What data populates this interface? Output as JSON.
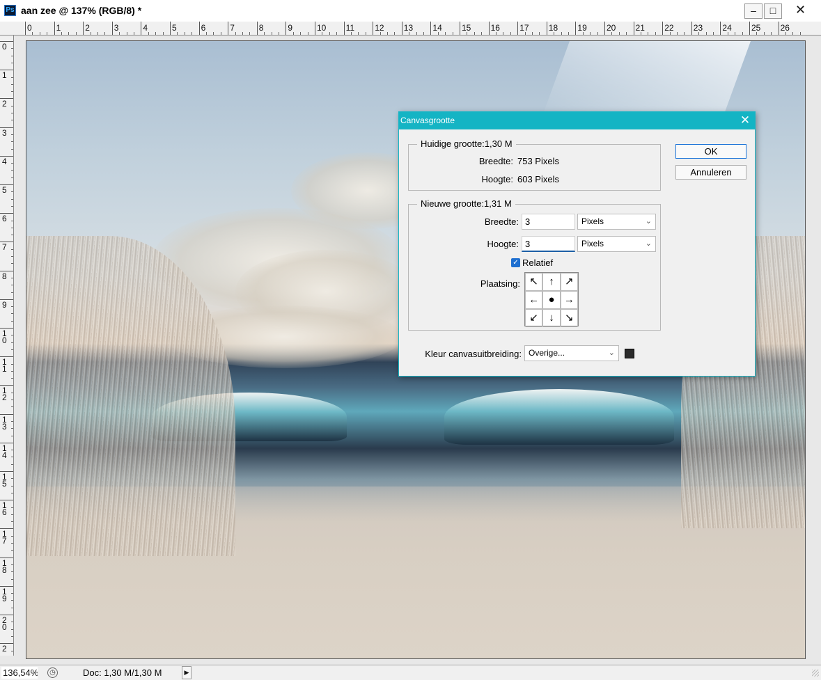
{
  "window": {
    "title": "aan zee @ 137% (RGB/8) *",
    "app_icon": "Ps",
    "controls": {
      "minimize": "–",
      "maximize": "□",
      "close": "✕"
    }
  },
  "ruler": {
    "top_numbers": [
      "0",
      "1",
      "2",
      "3",
      "4",
      "5",
      "6",
      "7",
      "8",
      "9",
      "10",
      "11",
      "12",
      "13",
      "14",
      "15",
      "16",
      "17",
      "18",
      "19",
      "20",
      "21",
      "22",
      "23",
      "24",
      "25",
      "26"
    ],
    "left_numbers": [
      "0",
      "1",
      "2",
      "3",
      "4",
      "5",
      "6",
      "7",
      "8",
      "9",
      "1 0",
      "1 1",
      "1 2",
      "1 3",
      "1 4",
      "1 5",
      "1 6",
      "1 7",
      "1 8",
      "1 9",
      "2 0",
      "2"
    ]
  },
  "status_bar": {
    "zoom": "136,54%",
    "doc_info": "Doc: 1,30 M/1,30 M",
    "arrow": "▶"
  },
  "dialog": {
    "title": "Canvasgrootte",
    "current": {
      "legend": "Huidige grootte:1,30 M",
      "width_label": "Breedte:",
      "width_value": "753 Pixels",
      "height_label": "Hoogte:",
      "height_value": "603 Pixels"
    },
    "new": {
      "legend": "Nieuwe grootte:1,31 M",
      "width_label": "Breedte:",
      "width_value": "3",
      "width_unit": "Pixels",
      "height_label": "Hoogte:",
      "height_value": "3",
      "height_unit": "Pixels",
      "relative_label": "Relatief",
      "relative_checked": true,
      "anchor_label": "Plaatsing:",
      "anchor_cells": [
        "↖",
        "↑",
        "↗",
        "←",
        "●",
        "→",
        "↙",
        "↓",
        "↘"
      ]
    },
    "extension_color_label": "Kleur canvasuitbreiding:",
    "extension_color_value": "Overige...",
    "ok_label": "OK",
    "cancel_label": "Annuleren",
    "accent_color": "#14b4c4"
  }
}
